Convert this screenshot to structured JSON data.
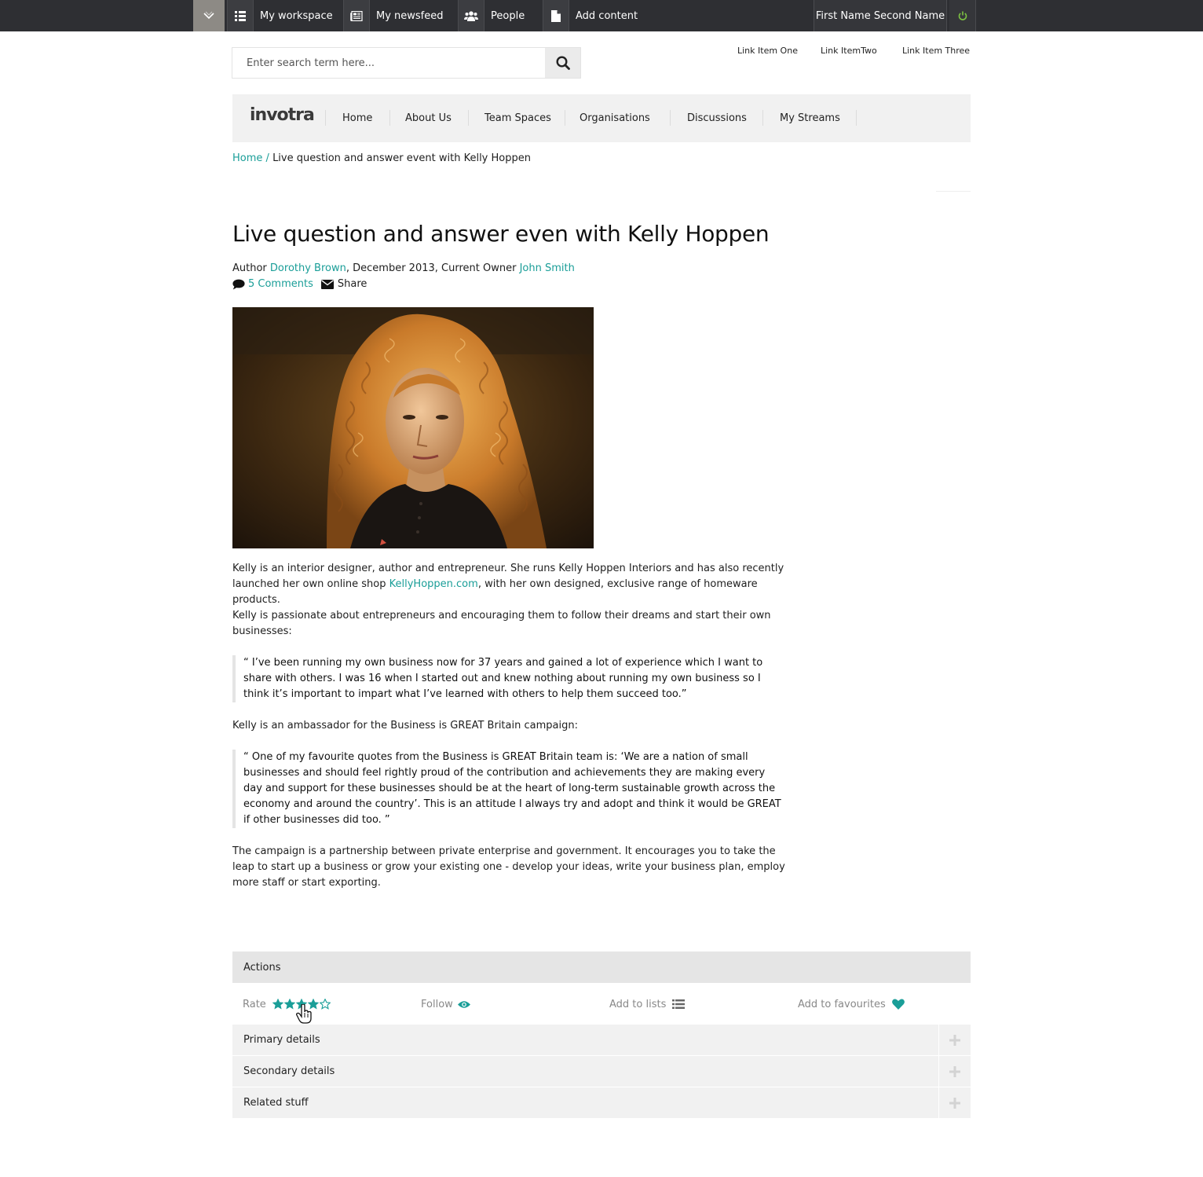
{
  "topbar": {
    "items": [
      {
        "label": "My workspace",
        "icon": "grid-list-icon"
      },
      {
        "label": "My newsfeed",
        "icon": "newspaper-icon"
      },
      {
        "label": "People",
        "icon": "users-icon"
      },
      {
        "label": "Add content",
        "icon": "file-icon"
      }
    ],
    "user_name": "First Name Second Name",
    "power_color": "#7dc242"
  },
  "search": {
    "placeholder": "Enter search term here..."
  },
  "utility_links": [
    "Link Item One",
    "Link ItemTwo",
    "Link Item Three"
  ],
  "nav": {
    "logo": "invotra",
    "items": [
      "Home",
      "About Us",
      "Team Spaces",
      "Organisations",
      "Discussions",
      "My Streams"
    ]
  },
  "breadcrumb": {
    "home": "Home",
    "separator": "/",
    "current": "Live question and answer event with Kelly Hoppen"
  },
  "article": {
    "title": "Live question and answer even with Kelly Hoppen",
    "author_prefix": "Author",
    "author": "Dorothy Brown",
    "date_text": ", December 2013, Current Owner",
    "owner": "John Smith",
    "comments": "5 Comments",
    "share": "Share",
    "p1_a": "Kelly is an interior designer, author and entrepreneur. She runs Kelly Hoppen Interiors and has also recently launched her own online shop ",
    "p1_link": "KellyHoppen.com",
    "p1_b": ", with her own designed, exclusive range of homeware products.",
    "p2": "Kelly is passionate about entrepreneurs and encouraging them to follow their dreams and start their own businesses:",
    "quote1": "“ I’ve been running my own business now for 37 years and gained a lot of experience which I want to share with others. I was 16 when I started out and knew nothing about running my own business so I think it’s important to impart what I’ve learned with others to help them succeed too.”",
    "p3": "Kelly is an ambassador for the Business is GREAT Britain campaign:",
    "quote2": "“ One of my favourite quotes from the Business is GREAT Britain team is: ‘We are a nation of small businesses and should feel rightly proud of the contribution and achievements they are making every day and support for these businesses should be at the heart of long-term sustainable growth across the economy and around the country’. This is an attitude I always try and adopt and think it would be GREAT if other businesses did too. ”",
    "p4": "The campaign is a partnership between private enterprise and government. It encourages you to take the leap to start up a business or grow your existing one - develop your ideas, write your business plan, employ more staff or start exporting."
  },
  "actions": {
    "heading": "Actions",
    "rate_label": "Rate",
    "rating": 4,
    "rating_max": 5,
    "follow_label": "Follow",
    "lists_label": "Add to lists",
    "favourites_label": "Add to favourites",
    "accent_color": "#1a9e98"
  },
  "accordion": [
    "Primary details",
    "Secondary details",
    "Related stuff"
  ]
}
